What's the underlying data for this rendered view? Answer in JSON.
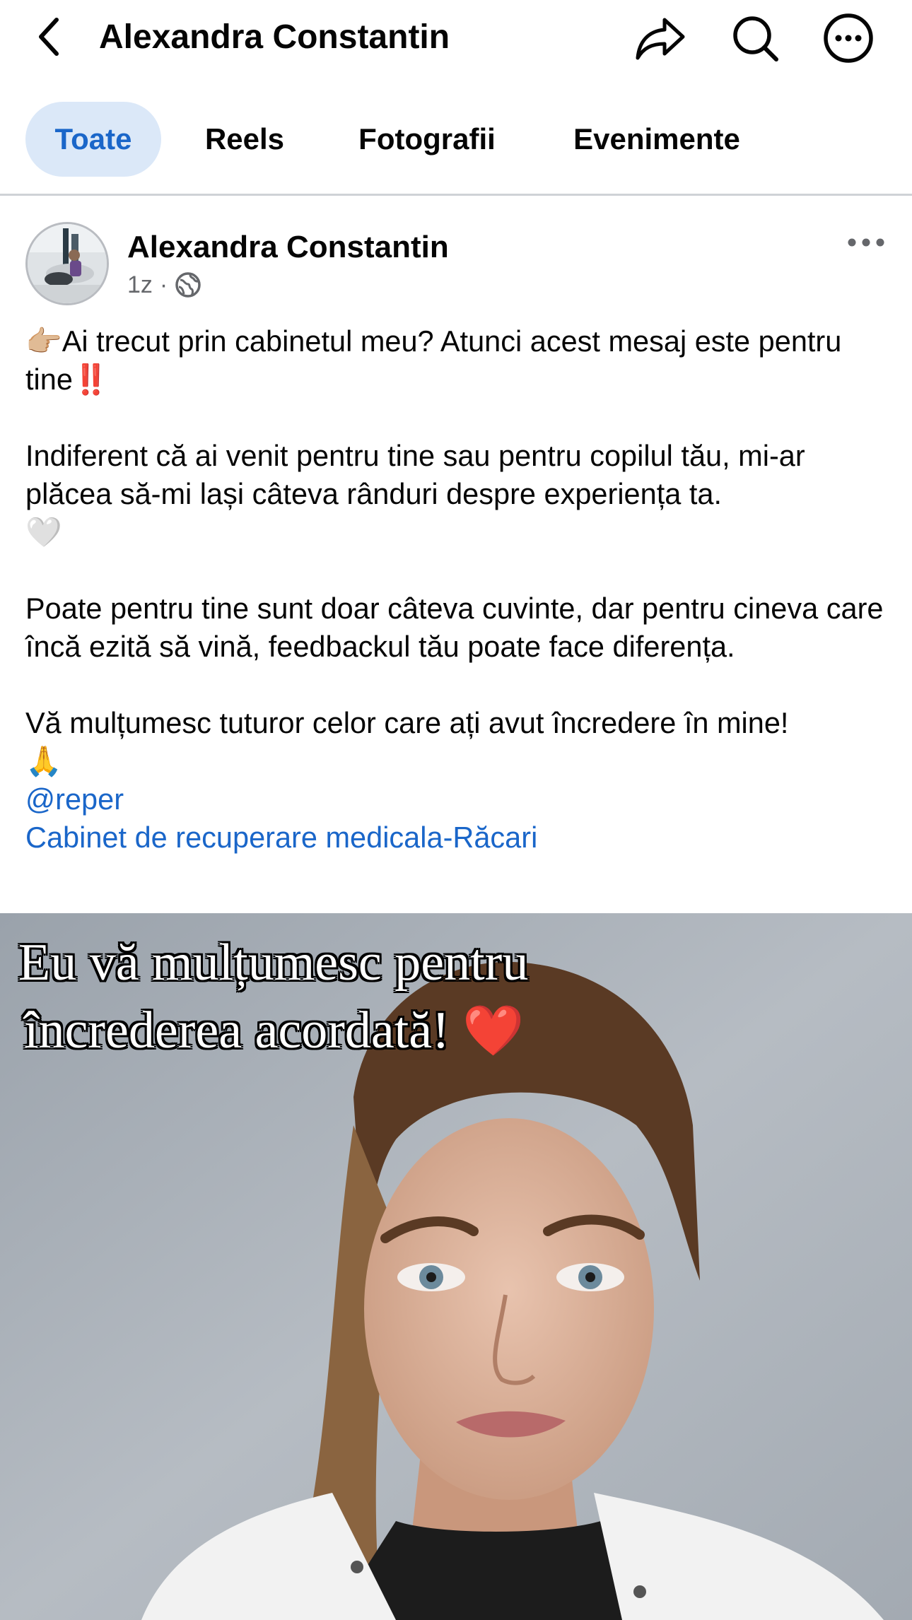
{
  "header": {
    "title": "Alexandra Constantin",
    "back_icon": "chevron-left-icon",
    "share_icon": "share-icon",
    "search_icon": "search-icon",
    "more_icon": "more-horizontal-circle-icon"
  },
  "tabs": [
    {
      "label": "Toate",
      "active": true
    },
    {
      "label": "Reels",
      "active": false
    },
    {
      "label": "Fotografii",
      "active": false
    },
    {
      "label": "Evenimente",
      "active": false
    }
  ],
  "post": {
    "author": "Alexandra Constantin",
    "time": "1z",
    "separator": "·",
    "audience_icon": "globe-icon",
    "paragraphs": {
      "p1_emoji": "👉🏼",
      "p1_text": "Ai trecut prin cabinetul meu? Atunci acest mesaj este pentru tine",
      "p1_end": "‼️",
      "p2_text": "Indiferent că ai venit pentru tine sau pentru copilul tău, mi-ar plăcea să-mi lași câteva rânduri despre experiența ta.",
      "p2_emoji": "🤍",
      "p3_text": "Poate pentru tine sunt doar câteva cuvinte, dar pentru cineva care încă ezită să vină, feedbackul tău poate face diferența.",
      "p4_text": "Vă mulțumesc tuturor celor care ați avut încredere în mine!",
      "p4_emoji": "🙏"
    },
    "mention": "@reper",
    "page_link": "Cabinet de recuperare medicala-Răcari",
    "photo_caption_line1": "Eu vă mulțumesc pentru",
    "photo_caption_line2": "încrederea acordată!",
    "photo_caption_emoji": "❤️"
  },
  "colors": {
    "accent": "#1a66c9",
    "active_tab_bg": "#dbe8f8",
    "secondary_text": "#65676b",
    "divider": "#cfd2d6"
  }
}
